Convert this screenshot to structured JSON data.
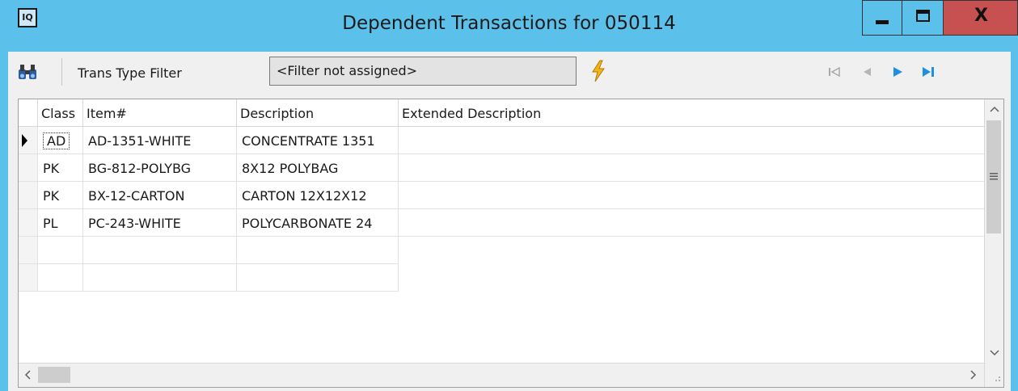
{
  "window": {
    "app_icon_text": "IQ",
    "title": "Dependent Transactions for 050114",
    "close_label": "X",
    "colors": {
      "titlebar": "#5cc1ea",
      "close": "#c75050",
      "bolt": "#f2b51b",
      "nav_active": "#1f8fe3"
    }
  },
  "toolbar": {
    "search_icon": "binoculars-icon",
    "trans_type_filter_label": "Trans Type Filter",
    "filter_value": "<Filter not assigned>",
    "apply_icon": "lightning-bolt-icon",
    "nav_icons": [
      "first-record-icon",
      "previous-record-icon",
      "next-record-icon",
      "last-record-icon"
    ]
  },
  "grid": {
    "columns": [
      "Class",
      "Item#",
      "Description",
      "Extended Description"
    ],
    "rows": [
      {
        "class": "AD",
        "item": "AD-1351-WHITE",
        "description": "CONCENTRATE 1351",
        "extended": ""
      },
      {
        "class": "PK",
        "item": "BG-812-POLYBG",
        "description": "8X12 POLYBAG",
        "extended": ""
      },
      {
        "class": "PK",
        "item": "BX-12-CARTON",
        "description": "CARTON 12X12X12",
        "extended": ""
      },
      {
        "class": "PL",
        "item": "PC-243-WHITE",
        "description": "POLYCARBONATE 24",
        "extended": ""
      }
    ],
    "selected_row": 0
  }
}
